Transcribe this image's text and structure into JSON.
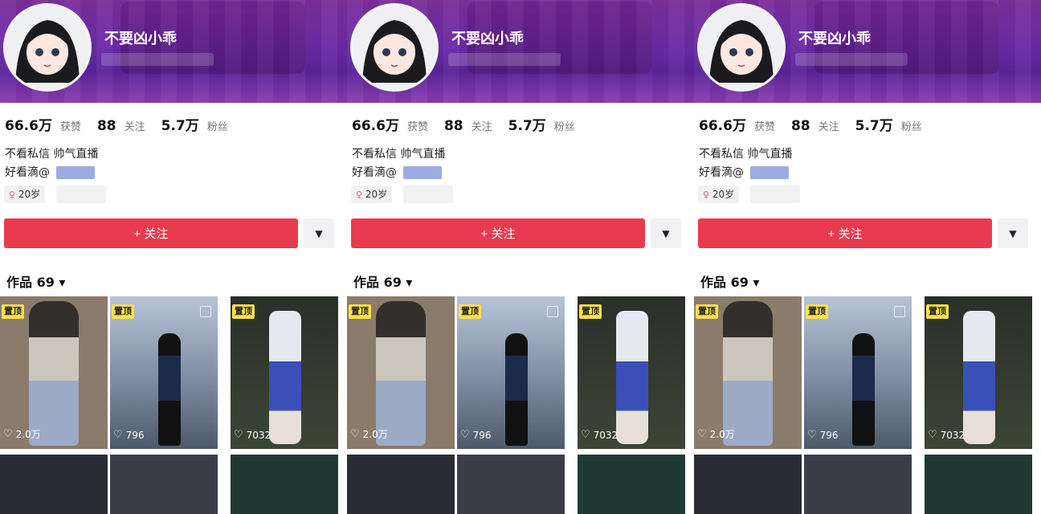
{
  "panels": [
    {
      "profile": {
        "name": "不要凶小乖"
      },
      "stats": [
        {
          "num": "66.6万",
          "label": "获赞"
        },
        {
          "num": "88",
          "label": "关注"
        },
        {
          "num": "5.7万",
          "label": "粉丝"
        }
      ],
      "bio": {
        "line1": "不看私信 帅气直播",
        "line2": "好看滴@"
      },
      "tags": {
        "age": "20岁",
        "location": ""
      },
      "actions": {
        "follow": "+ 关注",
        "more_icon": "caret-down-icon"
      },
      "works": {
        "label": "作品 69 ▾"
      },
      "tiles": [
        {
          "pin": "置顶",
          "likes": "2.0万",
          "bg": "#8b7b6a"
        },
        {
          "pin": "置顶",
          "likes": "796",
          "bg": "#5b6f86"
        },
        {
          "pin": "置顶",
          "likes": "7032",
          "bg": "#2f3a2c"
        },
        {
          "pin": "",
          "likes": "",
          "bg": "#2b2b33"
        },
        {
          "pin": "",
          "likes": "",
          "bg": "#3b3e48"
        },
        {
          "pin": "",
          "likes": "",
          "bg": "#1f3a33"
        }
      ]
    },
    {
      "profile": {
        "name": "不要凶小乖"
      },
      "stats": [
        {
          "num": "66.6万",
          "label": "获赞"
        },
        {
          "num": "88",
          "label": "关注"
        },
        {
          "num": "5.7万",
          "label": "粉丝"
        }
      ],
      "bio": {
        "line1": "不看私信 帅气直播",
        "line2": "好看滴@"
      },
      "tags": {
        "age": "20岁",
        "location": ""
      },
      "actions": {
        "follow": "+ 关注",
        "more_icon": "caret-down-icon"
      },
      "works": {
        "label": "作品 69 ▾"
      },
      "tiles": [
        {
          "pin": "置顶",
          "likes": "2.0万",
          "bg": "#8b7b6a"
        },
        {
          "pin": "置顶",
          "likes": "796",
          "bg": "#5b6f86"
        },
        {
          "pin": "置顶",
          "likes": "7032",
          "bg": "#2f3a2c"
        },
        {
          "pin": "",
          "likes": "",
          "bg": "#2b2b33"
        },
        {
          "pin": "",
          "likes": "",
          "bg": "#3b3e48"
        },
        {
          "pin": "",
          "likes": "",
          "bg": "#1f3a33"
        }
      ]
    },
    {
      "profile": {
        "name": "不要凶小乖"
      },
      "stats": [
        {
          "num": "66.6万",
          "label": "获赞"
        },
        {
          "num": "88",
          "label": "关注"
        },
        {
          "num": "5.7万",
          "label": "粉丝"
        }
      ],
      "bio": {
        "line1": "不看私信 帅气直播",
        "line2": "好看滴@"
      },
      "tags": {
        "age": "20岁",
        "location": ""
      },
      "actions": {
        "follow": "+ 关注",
        "more_icon": "caret-down-icon"
      },
      "works": {
        "label": "作品 69 ▾"
      },
      "tiles": [
        {
          "pin": "置顶",
          "likes": "2.0万",
          "bg": "#8b7b6a"
        },
        {
          "pin": "置顶",
          "likes": "796",
          "bg": "#5b6f86"
        },
        {
          "pin": "置顶",
          "likes": "7032",
          "bg": "#2f3a2c"
        },
        {
          "pin": "",
          "likes": "",
          "bg": "#2b2b33"
        },
        {
          "pin": "",
          "likes": "",
          "bg": "#3b3e48"
        },
        {
          "pin": "",
          "likes": "",
          "bg": "#1f3a33"
        }
      ]
    }
  ],
  "colors": {
    "accent": "#e93b50",
    "banner": "#6a2aa6",
    "pin": "#ffe14a"
  }
}
